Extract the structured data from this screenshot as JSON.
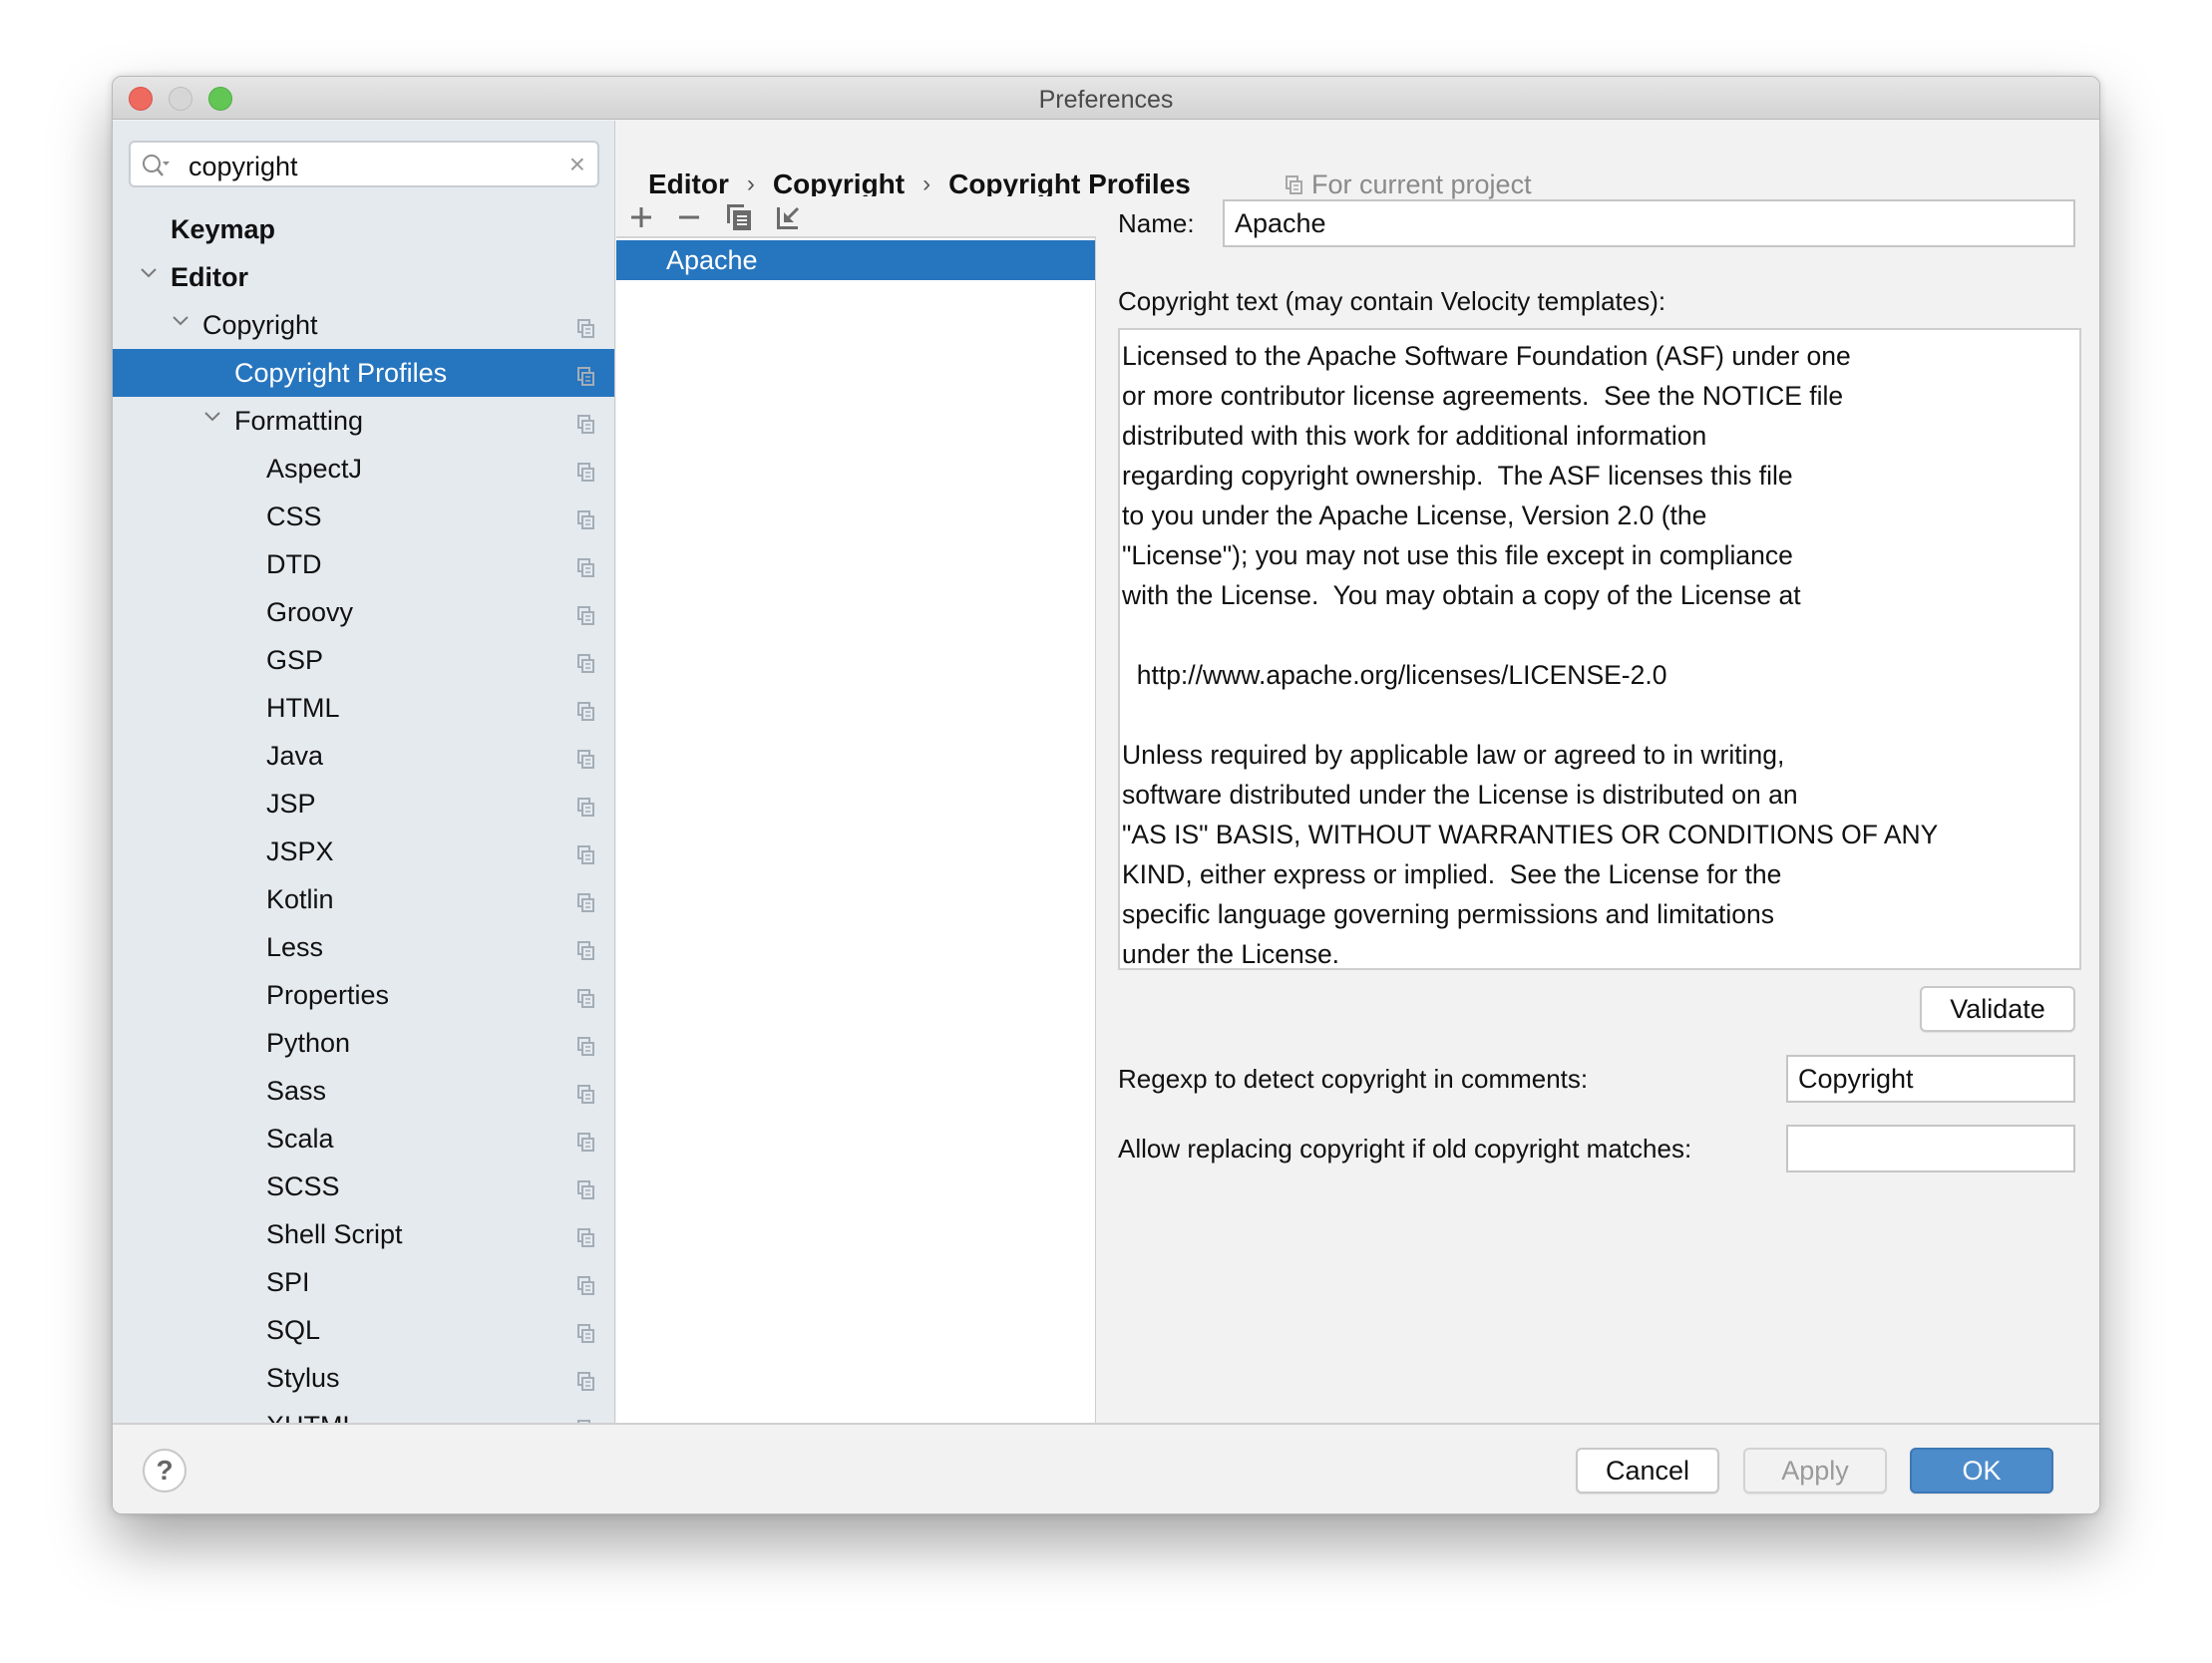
{
  "window": {
    "title": "Preferences"
  },
  "search": {
    "value": "copyright",
    "clear_icon": "close-icon"
  },
  "sidebar": {
    "items": [
      {
        "label": "Keymap",
        "level": 0,
        "bold": true,
        "expandable": false,
        "selected": false,
        "project_icon": false
      },
      {
        "label": "Editor",
        "level": 0,
        "bold": true,
        "expandable": true,
        "selected": false,
        "project_icon": false
      },
      {
        "label": "Copyright",
        "level": 1,
        "bold": false,
        "expandable": true,
        "selected": false,
        "project_icon": true
      },
      {
        "label": "Copyright Profiles",
        "level": 2,
        "bold": false,
        "expandable": false,
        "selected": true,
        "project_icon": true
      },
      {
        "label": "Formatting",
        "level": 2,
        "bold": false,
        "expandable": true,
        "selected": false,
        "project_icon": true
      },
      {
        "label": "AspectJ",
        "level": 3,
        "bold": false,
        "expandable": false,
        "selected": false,
        "project_icon": true
      },
      {
        "label": "CSS",
        "level": 3,
        "bold": false,
        "expandable": false,
        "selected": false,
        "project_icon": true
      },
      {
        "label": "DTD",
        "level": 3,
        "bold": false,
        "expandable": false,
        "selected": false,
        "project_icon": true
      },
      {
        "label": "Groovy",
        "level": 3,
        "bold": false,
        "expandable": false,
        "selected": false,
        "project_icon": true
      },
      {
        "label": "GSP",
        "level": 3,
        "bold": false,
        "expandable": false,
        "selected": false,
        "project_icon": true
      },
      {
        "label": "HTML",
        "level": 3,
        "bold": false,
        "expandable": false,
        "selected": false,
        "project_icon": true
      },
      {
        "label": "Java",
        "level": 3,
        "bold": false,
        "expandable": false,
        "selected": false,
        "project_icon": true
      },
      {
        "label": "JSP",
        "level": 3,
        "bold": false,
        "expandable": false,
        "selected": false,
        "project_icon": true
      },
      {
        "label": "JSPX",
        "level": 3,
        "bold": false,
        "expandable": false,
        "selected": false,
        "project_icon": true
      },
      {
        "label": "Kotlin",
        "level": 3,
        "bold": false,
        "expandable": false,
        "selected": false,
        "project_icon": true
      },
      {
        "label": "Less",
        "level": 3,
        "bold": false,
        "expandable": false,
        "selected": false,
        "project_icon": true
      },
      {
        "label": "Properties",
        "level": 3,
        "bold": false,
        "expandable": false,
        "selected": false,
        "project_icon": true
      },
      {
        "label": "Python",
        "level": 3,
        "bold": false,
        "expandable": false,
        "selected": false,
        "project_icon": true
      },
      {
        "label": "Sass",
        "level": 3,
        "bold": false,
        "expandable": false,
        "selected": false,
        "project_icon": true
      },
      {
        "label": "Scala",
        "level": 3,
        "bold": false,
        "expandable": false,
        "selected": false,
        "project_icon": true
      },
      {
        "label": "SCSS",
        "level": 3,
        "bold": false,
        "expandable": false,
        "selected": false,
        "project_icon": true
      },
      {
        "label": "Shell Script",
        "level": 3,
        "bold": false,
        "expandable": false,
        "selected": false,
        "project_icon": true
      },
      {
        "label": "SPI",
        "level": 3,
        "bold": false,
        "expandable": false,
        "selected": false,
        "project_icon": true
      },
      {
        "label": "SQL",
        "level": 3,
        "bold": false,
        "expandable": false,
        "selected": false,
        "project_icon": true
      },
      {
        "label": "Stylus",
        "level": 3,
        "bold": false,
        "expandable": false,
        "selected": false,
        "project_icon": true
      },
      {
        "label": "XHTML",
        "level": 3,
        "bold": false,
        "expandable": false,
        "selected": false,
        "project_icon": true
      }
    ]
  },
  "breadcrumb": [
    "Editor",
    "Copyright",
    "Copyright Profiles"
  ],
  "scope_hint": "For current project",
  "profiles_toolbar": [
    "add-icon",
    "remove-icon",
    "copy-icon",
    "import-icon"
  ],
  "profiles": [
    {
      "name": "Apache",
      "selected": true
    }
  ],
  "form": {
    "name_label": "Name:",
    "name_value": "Apache",
    "text_label": "Copyright text (may contain Velocity templates):",
    "text_value": "Licensed to the Apache Software Foundation (ASF) under one\nor more contributor license agreements.  See the NOTICE file\ndistributed with this work for additional information\nregarding copyright ownership.  The ASF licenses this file\nto you under the Apache License, Version 2.0 (the\n\"License\"); you may not use this file except in compliance\nwith the License.  You may obtain a copy of the License at\n\n  http://www.apache.org/licenses/LICENSE-2.0\n\nUnless required by applicable law or agreed to in writing,\nsoftware distributed under the License is distributed on an\n\"AS IS\" BASIS, WITHOUT WARRANTIES OR CONDITIONS OF ANY\nKIND, either express or implied.  See the License for the\nspecific language governing permissions and limitations\nunder the License.",
    "validate_label": "Validate",
    "regexp_label": "Regexp to detect copyright in comments:",
    "regexp_value": "Copyright",
    "replace_label": "Allow replacing copyright if old copyright matches:",
    "replace_value": ""
  },
  "footer": {
    "help_label": "?",
    "cancel_label": "Cancel",
    "apply_label": "Apply",
    "ok_label": "OK"
  },
  "colors": {
    "selection": "#2675bf",
    "primary_button": "#4d8ccb",
    "sidebar_bg": "#e5eaef",
    "close": "#ee6a5f",
    "zoom": "#62c655"
  }
}
